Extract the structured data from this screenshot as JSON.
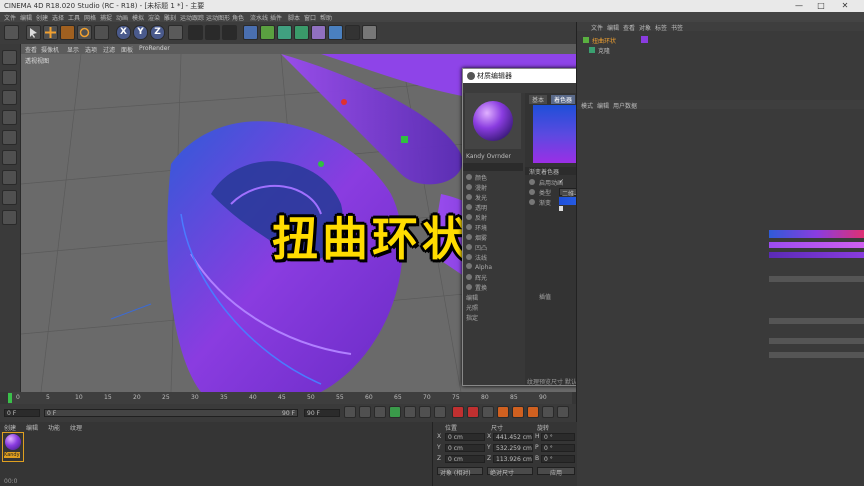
{
  "app": {
    "title": "CINEMA 4D R18.020 Studio (RC - R18) - [未标题 1 *] - 主要",
    "window_buttons": [
      "—",
      "□",
      "✕"
    ]
  },
  "menubar": {
    "items": [
      "文件",
      "编辑",
      "创建",
      "选择",
      "工具",
      "网格",
      "捕捉",
      "动画",
      "模拟",
      "渲染",
      "雕刻",
      "运动跟踪",
      "运动图形",
      "角色",
      "流水线",
      "插件",
      "脚本",
      "窗口",
      "帮助"
    ]
  },
  "toolbar": {
    "axes": [
      "X",
      "Y",
      "Z"
    ]
  },
  "viewport": {
    "tabs": [
      "查看",
      "摄像机",
      "显示",
      "选项",
      "过滤",
      "面板",
      "ProRender"
    ],
    "label": "透视视图"
  },
  "overlay": {
    "text": "扭曲环状造型"
  },
  "dialog": {
    "title": "材质编辑器",
    "buttons": [
      "—",
      "□",
      "✕"
    ],
    "material_name": "Kandy Ovrnder",
    "tabs": [
      "基本",
      "着色器"
    ],
    "channels": [
      "颜色",
      "漫射",
      "发光",
      "透明",
      "反射",
      "环境",
      "烟雾",
      "凹凸",
      "法线",
      "Alpha",
      "辉光",
      "置换",
      "编辑",
      "光照",
      "指定"
    ],
    "section_title": "渐变着色器",
    "rows": [
      {
        "label": "启用动画",
        "value": "✓"
      },
      {
        "label": "类型",
        "value": "二维-U"
      },
      {
        "label": "渐变",
        "value": ""
      }
    ],
    "interp": {
      "label": "插值",
      "value": "平滑"
    },
    "footer": "纹理预览尺寸 默认",
    "gradient_colors": [
      "#1e4fd8",
      "#3a7bff",
      "#8a3ce0",
      "#9b2fe6",
      "#7a2bd6"
    ]
  },
  "rightpanel": {
    "tabs": [
      "文件",
      "编辑",
      "查看",
      "对象",
      "标签",
      "书签"
    ],
    "objects": [
      "扭曲环状",
      "克隆"
    ],
    "attr_tabs": [
      "模式",
      "编辑",
      "用户数据"
    ]
  },
  "timeline": {
    "ticks": [
      "0",
      "5",
      "10",
      "15",
      "20",
      "25",
      "30",
      "35",
      "40",
      "45",
      "50",
      "55",
      "60",
      "65",
      "70",
      "75",
      "80",
      "85",
      "90"
    ],
    "start": "0 F",
    "end": "90 F",
    "current": "0 F",
    "frame": "00:0"
  },
  "materials": {
    "menu": [
      "创建",
      "编辑",
      "功能",
      "纹理"
    ],
    "swatch_label": "Kandy"
  },
  "coords": {
    "headers": [
      "位置",
      "尺寸",
      "旋转"
    ],
    "rows": [
      {
        "axis": "X",
        "pos": "0 cm",
        "size": "441.452 cm",
        "rot_axis": "H",
        "rot": "0 °"
      },
      {
        "axis": "Y",
        "pos": "0 cm",
        "size": "532.259 cm",
        "rot_axis": "P",
        "rot": "0 °"
      },
      {
        "axis": "Z",
        "pos": "0 cm",
        "size": "113.926 cm",
        "rot_axis": "B",
        "rot": "0 °"
      }
    ],
    "mode": "对象 (相对)",
    "size_mode": "绝对尺寸",
    "apply": "应用"
  },
  "colors": {
    "accent": "#ffdc00",
    "purple": "#8a3ce0",
    "blue": "#2f5bd8"
  }
}
